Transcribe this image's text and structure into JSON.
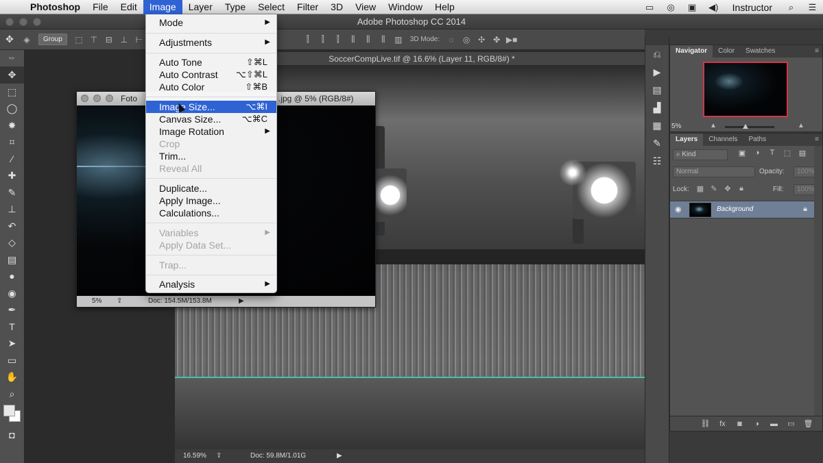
{
  "menubar": {
    "app": "Photoshop",
    "items": [
      "File",
      "Edit",
      "Image",
      "Layer",
      "Type",
      "Select",
      "Filter",
      "3D",
      "View",
      "Window",
      "Help"
    ],
    "active": "Image",
    "user": "Instructor"
  },
  "app_title": "Adobe Photoshop CC 2014",
  "options_bar": {
    "auto_select_value": "Group",
    "mode_3d_label": "3D Mode:"
  },
  "image_menu": {
    "mode": "Mode",
    "adjustments": "Adjustments",
    "auto_tone": {
      "label": "Auto Tone",
      "shortcut": "⇧⌘L"
    },
    "auto_contrast": {
      "label": "Auto Contrast",
      "shortcut": "⌥⇧⌘L"
    },
    "auto_color": {
      "label": "Auto Color",
      "shortcut": "⇧⌘B"
    },
    "image_size": {
      "label": "Image Size...",
      "shortcut": "⌥⌘I"
    },
    "canvas_size": {
      "label": "Canvas Size...",
      "shortcut": "⌥⌘C"
    },
    "image_rotation": "Image Rotation",
    "crop": "Crop",
    "trim": "Trim...",
    "reveal_all": "Reveal All",
    "duplicate": "Duplicate...",
    "apply_image": "Apply Image...",
    "calculations": "Calculations...",
    "variables": "Variables",
    "apply_data_set": "Apply Data Set...",
    "trap": "Trap...",
    "analysis": "Analysis"
  },
  "doc_main": {
    "tab_title": "SoccerCompLive.tif @ 16.6% (Layer 11, RGB/8#) *",
    "zoom": "16.59%",
    "doc_size": "Doc: 59.8M/1.01G"
  },
  "doc_foto": {
    "title_left": "Foto",
    "title_right": ".jpg @ 5% (RGB/8#)",
    "zoom": "5%",
    "doc_size": "Doc: 154.5M/153.8M"
  },
  "navigator_panel": {
    "tabs": [
      "Navigator",
      "Color",
      "Swatches"
    ],
    "zoom": "5%"
  },
  "layers_panel": {
    "tabs": [
      "Layers",
      "Channels",
      "Paths"
    ],
    "filter_kind": "Kind",
    "blend_mode": "Normal",
    "opacity_label": "Opacity:",
    "opacity_value": "100%",
    "lock_label": "Lock:",
    "fill_label": "Fill:",
    "fill_value": "100%",
    "layers": [
      {
        "name": "Background",
        "locked": true,
        "visible": true
      }
    ]
  }
}
